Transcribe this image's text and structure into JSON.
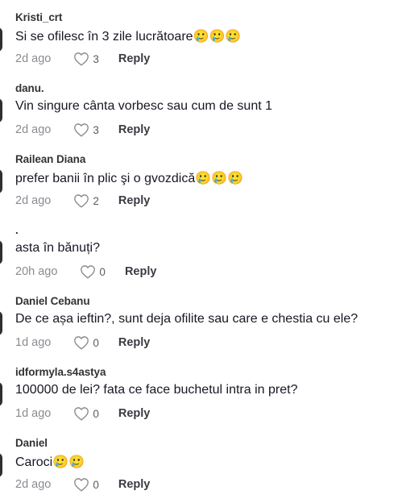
{
  "actions": {
    "reply_label": "Reply"
  },
  "comments": [
    {
      "username": "Kristi_crt",
      "text": "Si se ofilesc în 3 zile lucrătoare🥲🥲🥲",
      "time": "2d ago",
      "likes": "3"
    },
    {
      "username": "danu.",
      "text": "Vin singure cânta vorbesc sau cum de sunt 1",
      "time": "2d ago",
      "likes": "3"
    },
    {
      "username": "Railean Diana",
      "text": "prefer banii în plic şi o gvozdică🥲🥲🥲",
      "time": "2d ago",
      "likes": "2"
    },
    {
      "username": ".",
      "text": "asta în bănuți?",
      "time": "20h ago",
      "likes": "0"
    },
    {
      "username": "Daniel Cebanu",
      "text": "De ce așa ieftin?, sunt deja ofilite sau care e chestia cu ele?",
      "time": "1d ago",
      "likes": "0"
    },
    {
      "username": "idformyla.s4astya",
      "text": "100000 de lei? fata ce face buchetul intra in pret?",
      "time": "1d ago",
      "likes": "0"
    },
    {
      "username": "Daniel",
      "text": "Caroci🥲🥲",
      "time": "2d ago",
      "likes": "0"
    }
  ]
}
